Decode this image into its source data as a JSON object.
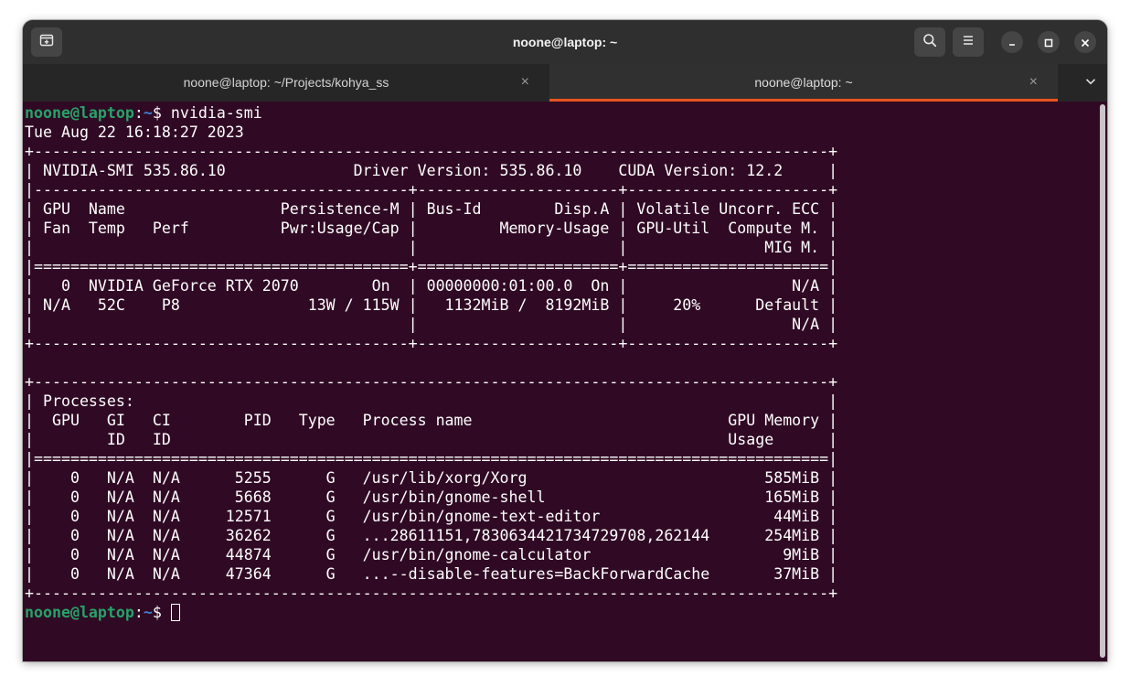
{
  "window": {
    "title": "noone@laptop: ~"
  },
  "tabs": [
    {
      "label": "noone@laptop: ~/Projects/kohya_ss",
      "close": "×",
      "active": false
    },
    {
      "label": "noone@laptop: ~",
      "close": "×",
      "active": true
    }
  ],
  "colors": {
    "terminal_bg": "#300a24",
    "prompt_user": "#26a269",
    "prompt_path": "#3f7fd6",
    "active_tab_underline": "#e95420"
  },
  "icons": {
    "new_tab": "new-tab-icon",
    "search": "search-icon",
    "menu": "hamburger-menu-icon",
    "minimize": "minimize-icon",
    "maximize": "maximize-icon",
    "close": "close-icon",
    "tab_dropdown": "chevron-down-icon"
  },
  "terminal": {
    "prompt1": {
      "user_host": "noone@laptop",
      "colon": ":",
      "path": "~",
      "dollar": "$ ",
      "command": "nvidia-smi"
    },
    "output": [
      "Tue Aug 22 16:18:27 2023",
      "+---------------------------------------------------------------------------------------+",
      "| NVIDIA-SMI 535.86.10              Driver Version: 535.86.10    CUDA Version: 12.2     |",
      "|-----------------------------------------+----------------------+----------------------+",
      "| GPU  Name                 Persistence-M | Bus-Id        Disp.A | Volatile Uncorr. ECC |",
      "| Fan  Temp   Perf          Pwr:Usage/Cap |         Memory-Usage | GPU-Util  Compute M. |",
      "|                                         |                      |               MIG M. |",
      "|=========================================+======================+======================|",
      "|   0  NVIDIA GeForce RTX 2070        On  | 00000000:01:00.0  On |                  N/A |",
      "| N/A   52C    P8              13W / 115W |   1132MiB /  8192MiB |     20%      Default |",
      "|                                         |                      |                  N/A |",
      "+-----------------------------------------+----------------------+----------------------+",
      "",
      "+---------------------------------------------------------------------------------------+",
      "| Processes:                                                                            |",
      "|  GPU   GI   CI        PID   Type   Process name                            GPU Memory |",
      "|        ID   ID                                                             Usage      |",
      "|=======================================================================================|",
      "|    0   N/A  N/A      5255      G   /usr/lib/xorg/Xorg                          585MiB |",
      "|    0   N/A  N/A      5668      G   /usr/bin/gnome-shell                        165MiB |",
      "|    0   N/A  N/A     12571      G   /usr/bin/gnome-text-editor                   44MiB |",
      "|    0   N/A  N/A     36262      G   ...28611151,7830634421734729708,262144      254MiB |",
      "|    0   N/A  N/A     44874      G   /usr/bin/gnome-calculator                     9MiB |",
      "|    0   N/A  N/A     47364      G   ...--disable-features=BackForwardCache       37MiB |",
      "+---------------------------------------------------------------------------------------+"
    ],
    "prompt2": {
      "user_host": "noone@laptop",
      "colon": ":",
      "path": "~",
      "dollar": "$ "
    }
  }
}
